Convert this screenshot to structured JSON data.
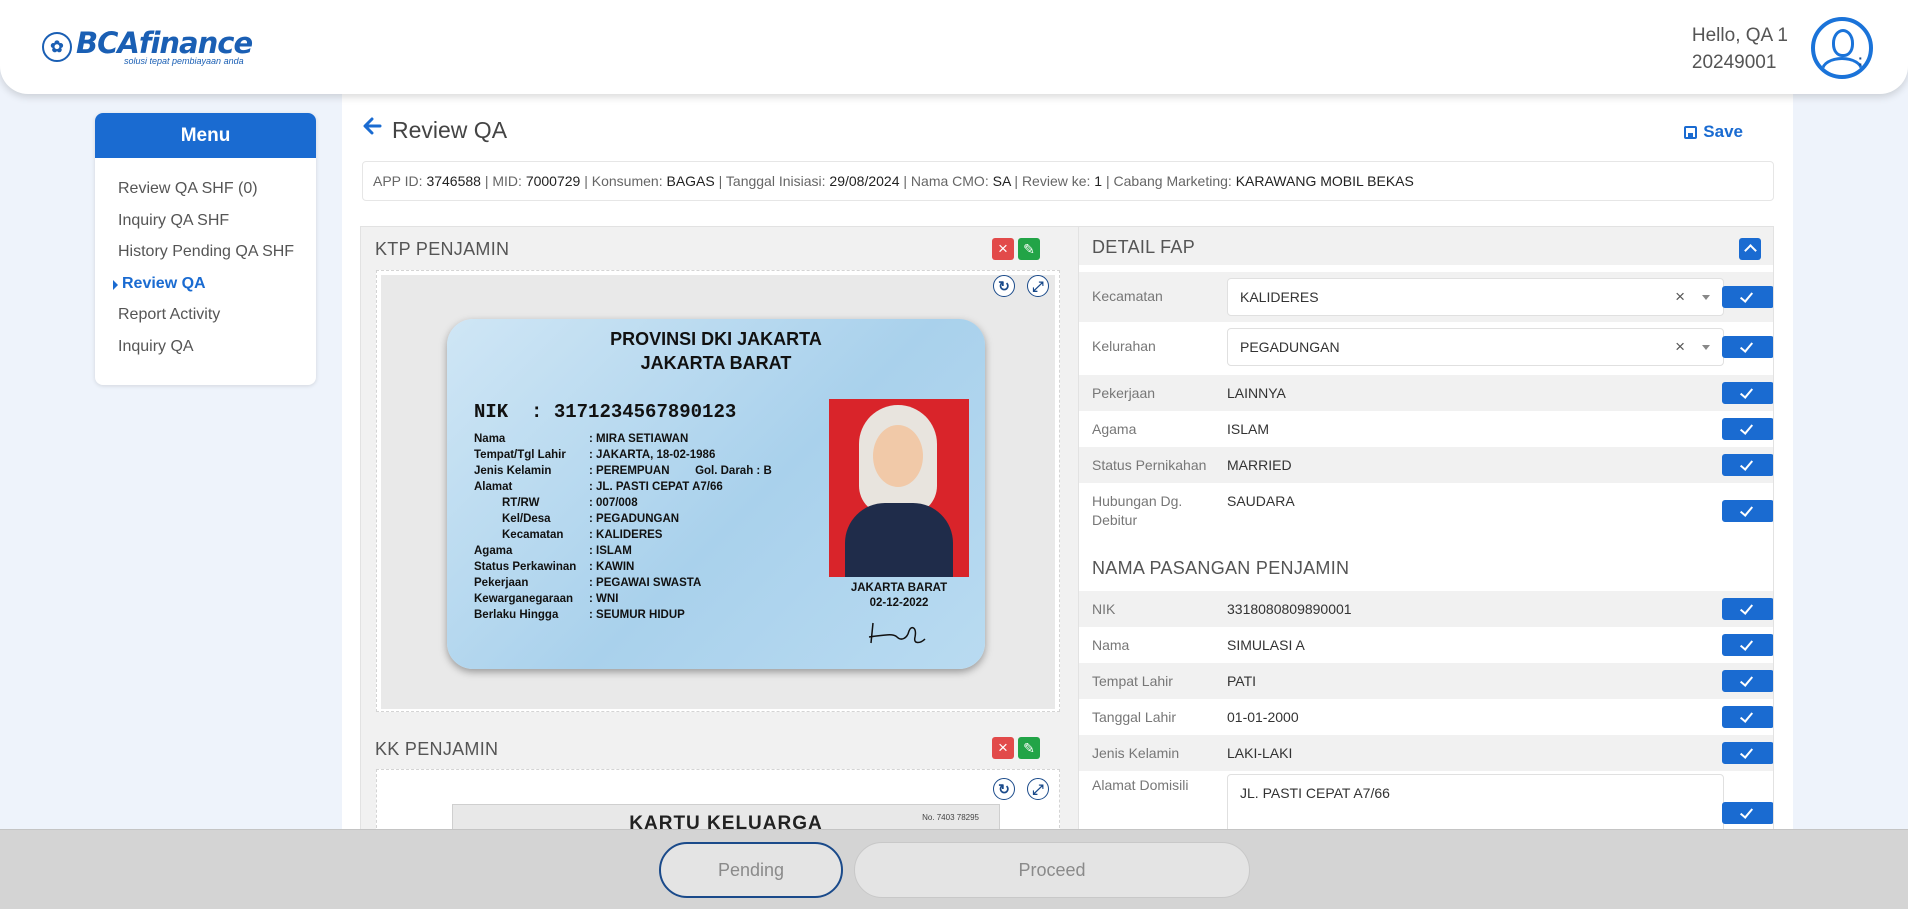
{
  "header": {
    "logo_text": "BCAfinance",
    "logo_tagline": "solusi tepat pembiayaan anda",
    "greeting": "Hello, QA 1",
    "user_id": "20249001"
  },
  "menu": {
    "title": "Menu",
    "items": [
      {
        "label": "Review QA SHF (0)",
        "active": false
      },
      {
        "label": "Inquiry QA SHF",
        "active": false
      },
      {
        "label": "History Pending QA SHF",
        "active": false
      },
      {
        "label": "Review QA",
        "active": true
      },
      {
        "label": "Report Activity",
        "active": false
      },
      {
        "label": "Inquiry QA",
        "active": false
      }
    ]
  },
  "page": {
    "title": "Review QA",
    "save_label": "Save"
  },
  "info": {
    "app_id_label": "APP ID:",
    "app_id": "3746588",
    "mid_label": "MID:",
    "mid": "7000729",
    "konsumen_label": "Konsumen:",
    "konsumen": "BAGAS",
    "tanggal_label": "Tanggal Inisiasi:",
    "tanggal": "29/08/2024",
    "cmo_label": "Nama CMO:",
    "cmo": "SA",
    "review_label": "Review ke:",
    "review": "1",
    "cabang_label": "Cabang Marketing:",
    "cabang": "KARAWANG MOBIL BEKAS",
    "sep": "|"
  },
  "docs": {
    "ktp_title": "KTP PENJAMIN",
    "kk_title": "KK PENJAMIN",
    "ktp_card": {
      "prov1": "PROVINSI DKI JAKARTA",
      "prov2": "JAKARTA BARAT",
      "nik_label": "NIK",
      "nik": ": 3171234567890123",
      "rows": [
        {
          "k": "Nama",
          "v": "MIRA SETIAWAN"
        },
        {
          "k": "Tempat/Tgl Lahir",
          "v": "JAKARTA, 18-02-1986"
        },
        {
          "k": "Jenis Kelamin",
          "v": "PEREMPUAN        Gol. Darah : B"
        },
        {
          "k": "Alamat",
          "v": "JL. PASTI CEPAT A7/66"
        },
        {
          "k": "RT/RW",
          "v": "007/008"
        },
        {
          "k": "Kel/Desa",
          "v": "PEGADUNGAN"
        },
        {
          "k": "Kecamatan",
          "v": "KALIDERES"
        },
        {
          "k": "Agama",
          "v": "ISLAM"
        },
        {
          "k": "Status Perkawinan",
          "v": "KAWIN"
        },
        {
          "k": "Pekerjaan",
          "v": "PEGAWAI SWASTA"
        },
        {
          "k": "Kewarganegaraan",
          "v": "WNI"
        },
        {
          "k": "Berlaku Hingga",
          "v": "SEUMUR HIDUP"
        }
      ],
      "city": "JAKARTA BARAT",
      "date": "02-12-2022"
    },
    "kk_card": {
      "title": "KARTU KELUARGA",
      "no": "No. 7403 78295"
    }
  },
  "fap": {
    "title": "DETAIL FAP",
    "kecamatan_label": "Kecamatan",
    "kecamatan": "KALIDERES",
    "kelurahan_label": "Kelurahan",
    "kelurahan": "PEGADUNGAN",
    "pekerjaan_label": "Pekerjaan",
    "pekerjaan": "LAINNYA",
    "agama_label": "Agama",
    "agama": "ISLAM",
    "status_label": "Status Pernikahan",
    "status": "MARRIED",
    "hubungan_label": "Hubungan Dg. Debitur",
    "hubungan": "SAUDARA",
    "pasangan_title": "NAMA PASANGAN PENJAMIN",
    "nik_label": "NIK",
    "nik": "3318080809890001",
    "nama_label": "Nama",
    "nama": "SIMULASI A",
    "tempat_label": "Tempat Lahir",
    "tempat": "PATI",
    "tanggal_label": "Tanggal Lahir",
    "tanggal": "01-01-2000",
    "jk_label": "Jenis Kelamin",
    "jk": "LAKI-LAKI",
    "alamat_label": "Alamat Domisili",
    "alamat": "JL. PASTI CEPAT A7/66"
  },
  "footer": {
    "pending_label": "Pending",
    "proceed_label": "Proceed"
  },
  "colors": {
    "primary": "#1a6bd1",
    "reject": "#e24a4a",
    "edit": "#22a447"
  }
}
